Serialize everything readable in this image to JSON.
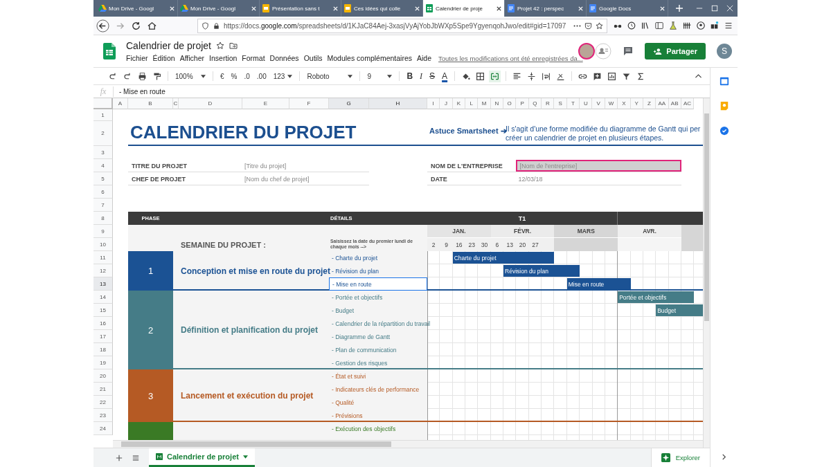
{
  "browser": {
    "tabs": [
      {
        "title": "Mon Drive - Googl",
        "kind": "drive",
        "selected": false
      },
      {
        "title": "Mon Drive - Googl",
        "kind": "drive",
        "selected": false
      },
      {
        "title": "Présentation sans t",
        "kind": "slides",
        "selected": false
      },
      {
        "title": "Ces idées qui colle",
        "kind": "slides",
        "selected": false
      },
      {
        "title": "Calendrier de proje",
        "kind": "sheets",
        "selected": true
      },
      {
        "title": "Projet 42 : perspec",
        "kind": "docs",
        "selected": false
      },
      {
        "title": "Google Docs",
        "kind": "docs",
        "selected": false
      }
    ],
    "url": "https://docs.**google.com**/spreadsheets/d/1KJaC84Aej-3xasjVyAjYobJbWXp5Spe9YgyenqohJwo/edit#gid=17097"
  },
  "doc": {
    "title": "Calendrier de projet",
    "menu": [
      "Fichier",
      "Édition",
      "Afficher",
      "Insertion",
      "Format",
      "Données",
      "Outils",
      "Modules complémentaires",
      "Aide"
    ],
    "save_status": "Toutes les modifications ont été enregistrées da...",
    "share_button": "Partager",
    "account_initial": "S"
  },
  "toolbar": {
    "zoom": "100%",
    "currency": "€",
    "percent": "%",
    "decrease_decimals": ".0",
    "increase_decimals": ".00",
    "number_format": "123",
    "font": "Roboto",
    "font_size": "9",
    "bold": "B",
    "italic": "I",
    "strikethrough": "S",
    "text_color": "A"
  },
  "formula_bar": {
    "label": "fx",
    "value": "- Mise en route"
  },
  "columns": [
    {
      "label": "A",
      "selected": false
    },
    {
      "label": "B",
      "selected": false
    },
    {
      "label": "C",
      "selected": false
    },
    {
      "label": "D",
      "selected": false
    },
    {
      "label": "E",
      "selected": false
    },
    {
      "label": "F",
      "selected": false
    },
    {
      "label": "G",
      "selected": true
    },
    {
      "label": "H",
      "selected": true
    },
    {
      "label": "I",
      "selected": false
    },
    {
      "label": "J",
      "selected": false
    },
    {
      "label": "K",
      "selected": false
    },
    {
      "label": "L",
      "selected": false
    },
    {
      "label": "M",
      "selected": false
    },
    {
      "label": "N",
      "selected": false
    },
    {
      "label": "O",
      "selected": false
    },
    {
      "label": "P",
      "selected": false
    },
    {
      "label": "Q",
      "selected": false
    },
    {
      "label": "R",
      "selected": false
    },
    {
      "label": "S",
      "selected": false
    },
    {
      "label": "T",
      "selected": false
    },
    {
      "label": "U",
      "selected": false
    },
    {
      "label": "V",
      "selected": false
    },
    {
      "label": "W",
      "selected": false
    },
    {
      "label": "X",
      "selected": false
    },
    {
      "label": "Y",
      "selected": false
    },
    {
      "label": "Z",
      "selected": false
    },
    {
      "label": "AA",
      "selected": false
    },
    {
      "label": "AB",
      "selected": false
    },
    {
      "label": "AC",
      "selected": false
    }
  ],
  "rows": [
    {
      "label": "1",
      "selected": false
    },
    {
      "label": "2",
      "selected": false
    },
    {
      "label": "3",
      "selected": false
    },
    {
      "label": "4",
      "selected": false
    },
    {
      "label": "5",
      "selected": false
    },
    {
      "label": "6",
      "selected": false
    },
    {
      "label": "7",
      "selected": false
    },
    {
      "label": "8",
      "selected": false
    },
    {
      "label": "9",
      "selected": false
    },
    {
      "label": "10",
      "selected": false
    },
    {
      "label": "11",
      "selected": false
    },
    {
      "label": "12",
      "selected": false
    },
    {
      "label": "13",
      "selected": true
    },
    {
      "label": "14",
      "selected": false
    },
    {
      "label": "15",
      "selected": false
    },
    {
      "label": "16",
      "selected": false
    },
    {
      "label": "17",
      "selected": false
    },
    {
      "label": "18",
      "selected": false
    },
    {
      "label": "19",
      "selected": false
    },
    {
      "label": "20",
      "selected": false
    },
    {
      "label": "21",
      "selected": false
    },
    {
      "label": "22",
      "selected": false
    },
    {
      "label": "23",
      "selected": false
    },
    {
      "label": "24",
      "selected": false
    }
  ],
  "sheet": {
    "title": "CALENDRIER DU PROJET",
    "tip_label": "Astuce Smartsheet ➔",
    "tip_lines": [
      "Il s'agit d'une forme modifiée du diagramme de Gantt qui per",
      "créer un calendrier de projet en plusieurs étapes."
    ],
    "fields": [
      {
        "label": "TITRE DU PROJET",
        "value": "[Titre du projet]",
        "selected": false
      },
      {
        "label": "CHEF DE PROJET",
        "value": "[Nom du chef de projet]",
        "selected": false
      },
      {
        "label": "NOM DE L'ENTREPRISE",
        "value": "[Nom de l'entreprise]",
        "selected": true
      },
      {
        "label": "DATE",
        "value": "12/03/18",
        "selected": false
      }
    ]
  },
  "table": {
    "phase_header": "PHASE",
    "details_header": "DÉTAILS",
    "quarter": "T1",
    "week_label": "SEMAINE DU PROJET :",
    "date_hint": "Saisissez la date du premier lundi de chaque mois -->",
    "months": [
      {
        "label": "JAN.",
        "dates": [
          "2",
          "9",
          "16",
          "23",
          "30"
        ]
      },
      {
        "label": "FÉVR.",
        "dates": [
          "6",
          "13",
          "20",
          "27"
        ]
      },
      {
        "label": "MARS"
      },
      {
        "label": "AVR."
      }
    ],
    "phases": [
      {
        "number": "1",
        "title": "Conception et mise en route du projet",
        "color": "#1b5294",
        "tasks": [
          {
            "label": "- Charte du projet",
            "bar": "Charte du projet",
            "selected": false
          },
          {
            "label": "- Révision du plan",
            "bar": "Révision du plan",
            "selected": false
          },
          {
            "label": "- Mise en route",
            "bar": "Mise en route",
            "selected": true
          }
        ]
      },
      {
        "number": "2",
        "title": "Définition et planification du projet",
        "color": "#457c87",
        "tasks": [
          {
            "label": "- Portée et objectifs",
            "bar": "Portée et objectifs",
            "selected": false
          },
          {
            "label": "- Budget",
            "bar": "Budget",
            "selected": false
          },
          {
            "label": "- Calendrier de la répartition du travail",
            "selected": false
          },
          {
            "label": "- Diagramme de Gantt",
            "selected": false
          },
          {
            "label": "- Plan de communication",
            "selected": false
          },
          {
            "label": "- Gestion des risques",
            "selected": false
          }
        ]
      },
      {
        "number": "3",
        "title": "Lancement et exécution du projet",
        "color": "#b55a24",
        "tasks": [
          {
            "label": "- État et suivi",
            "selected": false
          },
          {
            "label": "- Indicateurs clés de performance",
            "selected": false
          },
          {
            "label": "- Qualité",
            "selected": false
          },
          {
            "label": "- Prévisions",
            "selected": false
          }
        ]
      },
      {
        "color": "#3a7a25",
        "tasks": [
          {
            "label": "- Exécution des objectifs",
            "selected": false
          }
        ]
      }
    ]
  },
  "sheet_tabs": [
    {
      "label": "Calendrier de projet",
      "selected": true
    }
  ],
  "explore_button": "Explorer"
}
